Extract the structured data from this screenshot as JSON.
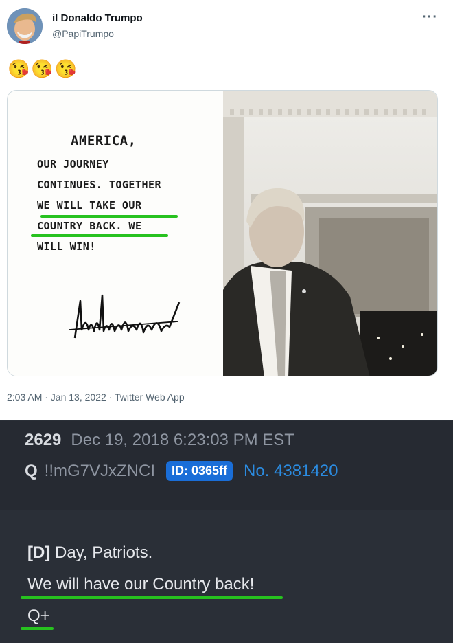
{
  "tweet": {
    "display_name": "il Donaldo Trumpo",
    "handle": "@PapiTrumpo",
    "more_icon": "more-icon",
    "emojis": [
      "😘",
      "😘",
      "😘"
    ],
    "note_lines": [
      "America,",
      "Our journey",
      "continues. Together",
      "We will take our",
      "Country back. We",
      "will WIN!"
    ],
    "timestamp": "2:03 AM · Jan 13, 2022 · Twitter Web App",
    "highlight_color": "#27c21f"
  },
  "qpost": {
    "number": "2629",
    "date": "Dec 19, 2018 6:23:03 PM EST",
    "name": "Q",
    "tripcode": "!!mG7VJxZNCI",
    "id_badge": "ID: 0365ff",
    "post_no": "No. 4381420",
    "line1_tag": "[D]",
    "line1_text": " Day, Patriots.",
    "line2": "We will have our Country back!",
    "line3": "Q+"
  }
}
